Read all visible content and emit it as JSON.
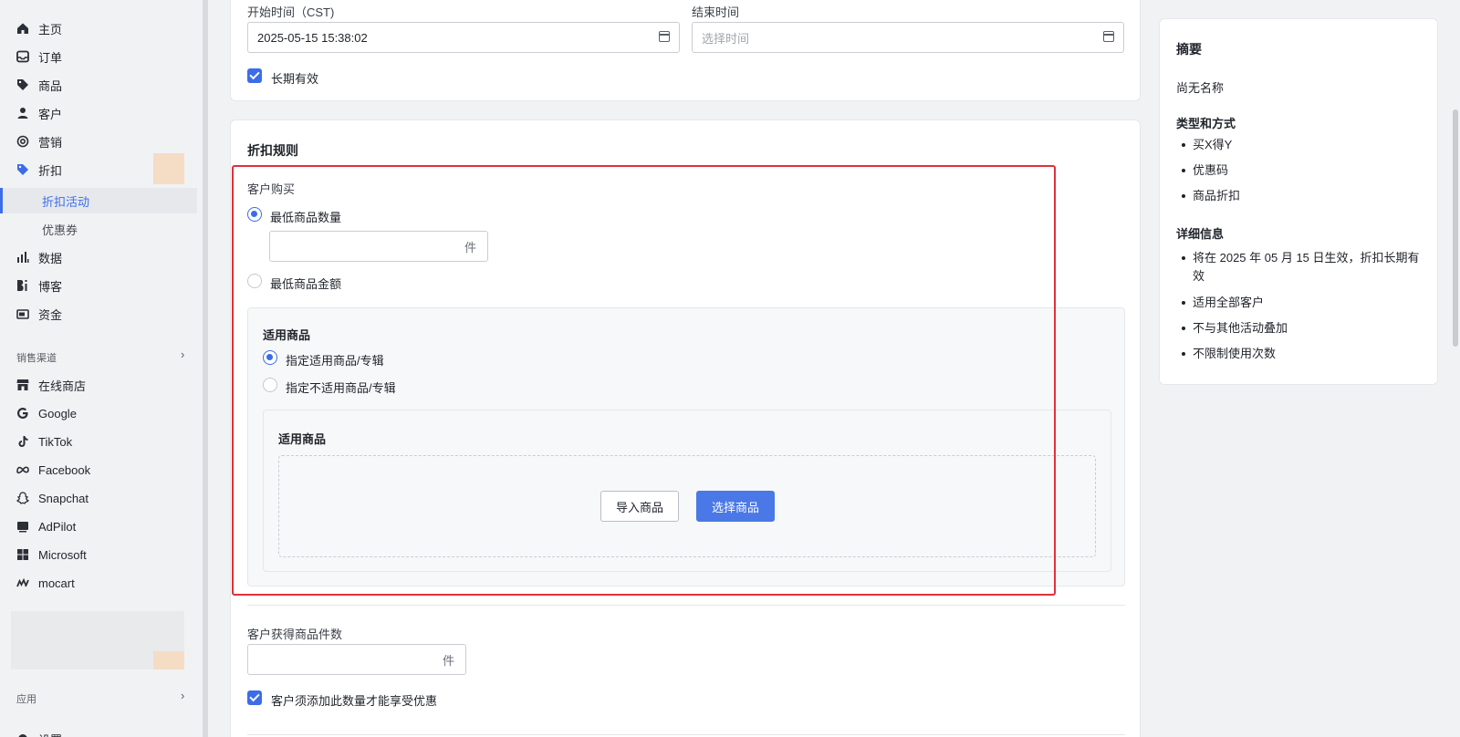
{
  "sidebar": {
    "items": [
      {
        "label": "主页",
        "icon": "home-icon"
      },
      {
        "label": "订单",
        "icon": "inbox-icon"
      },
      {
        "label": "商品",
        "icon": "tag-icon"
      },
      {
        "label": "客户",
        "icon": "person-icon"
      },
      {
        "label": "营销",
        "icon": "target-icon"
      },
      {
        "label": "折扣",
        "icon": "discount-icon"
      }
    ],
    "sub_items": [
      {
        "label": "折扣活动"
      },
      {
        "label": "优惠券"
      }
    ],
    "items2": [
      {
        "label": "数据",
        "icon": "bar-chart-icon"
      },
      {
        "label": "博客",
        "icon": "blog-icon"
      },
      {
        "label": "资金",
        "icon": "wallet-icon"
      }
    ],
    "channels_label": "销售渠道",
    "channels": [
      {
        "label": "在线商店",
        "icon": "store-icon"
      },
      {
        "label": "Google",
        "icon": "google-icon"
      },
      {
        "label": "TikTok",
        "icon": "tiktok-icon"
      },
      {
        "label": "Facebook",
        "icon": "meta-icon"
      },
      {
        "label": "Snapchat",
        "icon": "snapchat-icon"
      },
      {
        "label": "AdPilot",
        "icon": "ad-icon"
      },
      {
        "label": "Microsoft",
        "icon": "microsoft-icon"
      },
      {
        "label": "mocart",
        "icon": "mocart-icon"
      }
    ],
    "apps_label": "应用",
    "settings_label": "设置"
  },
  "time": {
    "start_label": "开始时间（CST)",
    "start_value": "2025-05-15 15:38:02",
    "end_label": "结束时间",
    "end_placeholder": "选择时间",
    "long_term_label": "长期有效"
  },
  "rules": {
    "title": "折扣规则",
    "customer_buy_label": "客户购买",
    "min_qty_label": "最低商品数量",
    "unit": "件",
    "min_amount_label": "最低商品金额",
    "applicable_title": "适用商品",
    "opt_include": "指定适用商品/专辑",
    "opt_exclude": "指定不适用商品/专辑",
    "products_title": "适用商品",
    "import_button": "导入商品",
    "select_button": "选择商品",
    "get_qty_label": "客户获得商品件数",
    "get_unit": "件",
    "must_add_label": "客户须添加此数量才能享受优惠"
  },
  "summary": {
    "title": "摘要",
    "no_name": "尚无名称",
    "type_title": "类型和方式",
    "types": [
      "买X得Y",
      "优惠码",
      "商品折扣"
    ],
    "detail_title": "详细信息",
    "details": [
      "将在 2025 年 05 月 15 日生效，折扣长期有效",
      "适用全部客户",
      "不与其他活动叠加",
      "不限制使用次数"
    ]
  },
  "colors": {
    "accent": "#3c6de8",
    "highlight": "#e0303a"
  }
}
